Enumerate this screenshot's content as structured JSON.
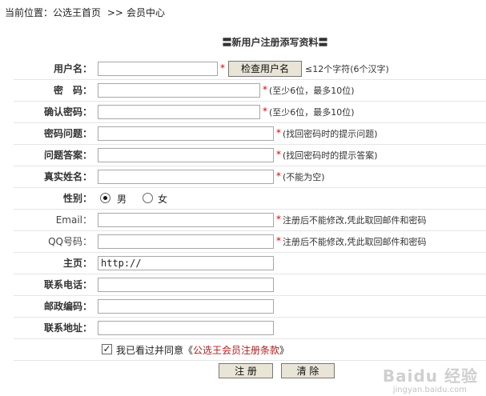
{
  "breadcrumb": {
    "prefix": "当前位置：",
    "home": "公选王首页",
    "sep": ">>",
    "current": "会员中心"
  },
  "title": "〓新用户注册添写资料〓",
  "fields": {
    "username": {
      "label": "用户名：",
      "value": "",
      "star": "*",
      "button": "检查用户名",
      "hint": "≤12个字符(6个汉字)"
    },
    "password": {
      "label": "密　码：",
      "value": "",
      "star": "*",
      "hint": "(至少6位，最多10位)"
    },
    "confirm": {
      "label": "确认密码：",
      "value": "",
      "star": "*",
      "hint": "(至少6位，最多10位)"
    },
    "question": {
      "label": "密码问题：",
      "value": "",
      "star": "*",
      "hint": "(找回密码时的提示问题)"
    },
    "answer": {
      "label": "问题答案：",
      "value": "",
      "star": "*",
      "hint": "(找回密码时的提示答案)"
    },
    "realname": {
      "label": "真实姓名：",
      "value": "",
      "star": "*",
      "hint": "(不能为空)"
    },
    "gender": {
      "label": "性别：",
      "male": "男",
      "female": "女",
      "selected": "男"
    },
    "email": {
      "label": "Email：",
      "value": "",
      "star": "*",
      "hint": "注册后不能修改,凭此取回邮件和密码"
    },
    "qq": {
      "label": "QQ号码：",
      "value": "",
      "star": "*",
      "hint": "注册后不能修改,凭此取回邮件和密码"
    },
    "homepage": {
      "label": "主页：",
      "value": "http://"
    },
    "phone": {
      "label": "联系电话：",
      "value": ""
    },
    "zipcode": {
      "label": "邮政编码：",
      "value": ""
    },
    "address": {
      "label": "联系地址：",
      "value": ""
    }
  },
  "agree": {
    "text": "我已看过并同意《",
    "link": "公选王会员注册条款",
    "close": "》",
    "checked": true
  },
  "buttons": {
    "submit": "注 册",
    "reset": "清 除"
  },
  "watermark": {
    "main": "Baidu 经验",
    "sub": "jingyan.baidu.com"
  }
}
